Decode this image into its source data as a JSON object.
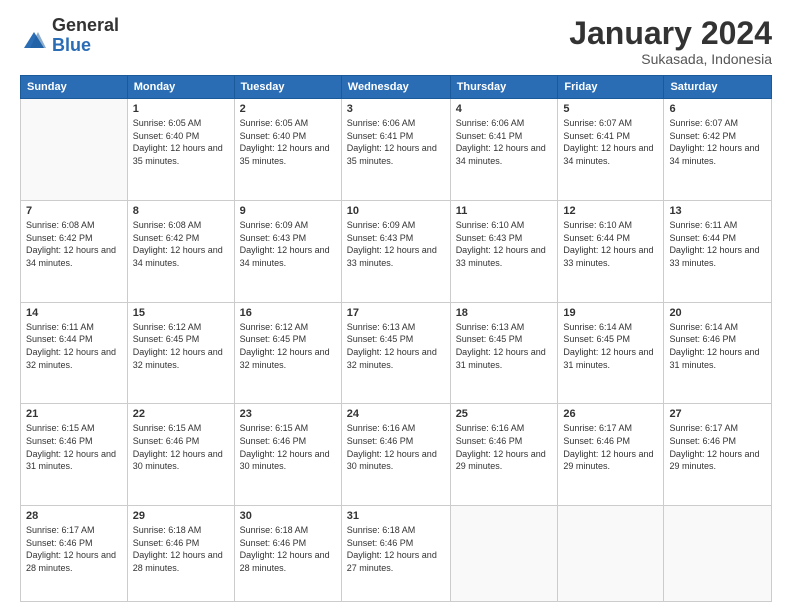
{
  "logo": {
    "general": "General",
    "blue": "Blue"
  },
  "header": {
    "month": "January 2024",
    "location": "Sukasada, Indonesia"
  },
  "weekdays": [
    "Sunday",
    "Monday",
    "Tuesday",
    "Wednesday",
    "Thursday",
    "Friday",
    "Saturday"
  ],
  "weeks": [
    [
      {
        "day": "",
        "sunrise": "",
        "sunset": "",
        "daylight": ""
      },
      {
        "day": "1",
        "sunrise": "Sunrise: 6:05 AM",
        "sunset": "Sunset: 6:40 PM",
        "daylight": "Daylight: 12 hours and 35 minutes."
      },
      {
        "day": "2",
        "sunrise": "Sunrise: 6:05 AM",
        "sunset": "Sunset: 6:40 PM",
        "daylight": "Daylight: 12 hours and 35 minutes."
      },
      {
        "day": "3",
        "sunrise": "Sunrise: 6:06 AM",
        "sunset": "Sunset: 6:41 PM",
        "daylight": "Daylight: 12 hours and 35 minutes."
      },
      {
        "day": "4",
        "sunrise": "Sunrise: 6:06 AM",
        "sunset": "Sunset: 6:41 PM",
        "daylight": "Daylight: 12 hours and 34 minutes."
      },
      {
        "day": "5",
        "sunrise": "Sunrise: 6:07 AM",
        "sunset": "Sunset: 6:41 PM",
        "daylight": "Daylight: 12 hours and 34 minutes."
      },
      {
        "day": "6",
        "sunrise": "Sunrise: 6:07 AM",
        "sunset": "Sunset: 6:42 PM",
        "daylight": "Daylight: 12 hours and 34 minutes."
      }
    ],
    [
      {
        "day": "7",
        "sunrise": "Sunrise: 6:08 AM",
        "sunset": "Sunset: 6:42 PM",
        "daylight": "Daylight: 12 hours and 34 minutes."
      },
      {
        "day": "8",
        "sunrise": "Sunrise: 6:08 AM",
        "sunset": "Sunset: 6:42 PM",
        "daylight": "Daylight: 12 hours and 34 minutes."
      },
      {
        "day": "9",
        "sunrise": "Sunrise: 6:09 AM",
        "sunset": "Sunset: 6:43 PM",
        "daylight": "Daylight: 12 hours and 34 minutes."
      },
      {
        "day": "10",
        "sunrise": "Sunrise: 6:09 AM",
        "sunset": "Sunset: 6:43 PM",
        "daylight": "Daylight: 12 hours and 33 minutes."
      },
      {
        "day": "11",
        "sunrise": "Sunrise: 6:10 AM",
        "sunset": "Sunset: 6:43 PM",
        "daylight": "Daylight: 12 hours and 33 minutes."
      },
      {
        "day": "12",
        "sunrise": "Sunrise: 6:10 AM",
        "sunset": "Sunset: 6:44 PM",
        "daylight": "Daylight: 12 hours and 33 minutes."
      },
      {
        "day": "13",
        "sunrise": "Sunrise: 6:11 AM",
        "sunset": "Sunset: 6:44 PM",
        "daylight": "Daylight: 12 hours and 33 minutes."
      }
    ],
    [
      {
        "day": "14",
        "sunrise": "Sunrise: 6:11 AM",
        "sunset": "Sunset: 6:44 PM",
        "daylight": "Daylight: 12 hours and 32 minutes."
      },
      {
        "day": "15",
        "sunrise": "Sunrise: 6:12 AM",
        "sunset": "Sunset: 6:45 PM",
        "daylight": "Daylight: 12 hours and 32 minutes."
      },
      {
        "day": "16",
        "sunrise": "Sunrise: 6:12 AM",
        "sunset": "Sunset: 6:45 PM",
        "daylight": "Daylight: 12 hours and 32 minutes."
      },
      {
        "day": "17",
        "sunrise": "Sunrise: 6:13 AM",
        "sunset": "Sunset: 6:45 PM",
        "daylight": "Daylight: 12 hours and 32 minutes."
      },
      {
        "day": "18",
        "sunrise": "Sunrise: 6:13 AM",
        "sunset": "Sunset: 6:45 PM",
        "daylight": "Daylight: 12 hours and 31 minutes."
      },
      {
        "day": "19",
        "sunrise": "Sunrise: 6:14 AM",
        "sunset": "Sunset: 6:45 PM",
        "daylight": "Daylight: 12 hours and 31 minutes."
      },
      {
        "day": "20",
        "sunrise": "Sunrise: 6:14 AM",
        "sunset": "Sunset: 6:46 PM",
        "daylight": "Daylight: 12 hours and 31 minutes."
      }
    ],
    [
      {
        "day": "21",
        "sunrise": "Sunrise: 6:15 AM",
        "sunset": "Sunset: 6:46 PM",
        "daylight": "Daylight: 12 hours and 31 minutes."
      },
      {
        "day": "22",
        "sunrise": "Sunrise: 6:15 AM",
        "sunset": "Sunset: 6:46 PM",
        "daylight": "Daylight: 12 hours and 30 minutes."
      },
      {
        "day": "23",
        "sunrise": "Sunrise: 6:15 AM",
        "sunset": "Sunset: 6:46 PM",
        "daylight": "Daylight: 12 hours and 30 minutes."
      },
      {
        "day": "24",
        "sunrise": "Sunrise: 6:16 AM",
        "sunset": "Sunset: 6:46 PM",
        "daylight": "Daylight: 12 hours and 30 minutes."
      },
      {
        "day": "25",
        "sunrise": "Sunrise: 6:16 AM",
        "sunset": "Sunset: 6:46 PM",
        "daylight": "Daylight: 12 hours and 29 minutes."
      },
      {
        "day": "26",
        "sunrise": "Sunrise: 6:17 AM",
        "sunset": "Sunset: 6:46 PM",
        "daylight": "Daylight: 12 hours and 29 minutes."
      },
      {
        "day": "27",
        "sunrise": "Sunrise: 6:17 AM",
        "sunset": "Sunset: 6:46 PM",
        "daylight": "Daylight: 12 hours and 29 minutes."
      }
    ],
    [
      {
        "day": "28",
        "sunrise": "Sunrise: 6:17 AM",
        "sunset": "Sunset: 6:46 PM",
        "daylight": "Daylight: 12 hours and 28 minutes."
      },
      {
        "day": "29",
        "sunrise": "Sunrise: 6:18 AM",
        "sunset": "Sunset: 6:46 PM",
        "daylight": "Daylight: 12 hours and 28 minutes."
      },
      {
        "day": "30",
        "sunrise": "Sunrise: 6:18 AM",
        "sunset": "Sunset: 6:46 PM",
        "daylight": "Daylight: 12 hours and 28 minutes."
      },
      {
        "day": "31",
        "sunrise": "Sunrise: 6:18 AM",
        "sunset": "Sunset: 6:46 PM",
        "daylight": "Daylight: 12 hours and 27 minutes."
      },
      {
        "day": "",
        "sunrise": "",
        "sunset": "",
        "daylight": ""
      },
      {
        "day": "",
        "sunrise": "",
        "sunset": "",
        "daylight": ""
      },
      {
        "day": "",
        "sunrise": "",
        "sunset": "",
        "daylight": ""
      }
    ]
  ]
}
